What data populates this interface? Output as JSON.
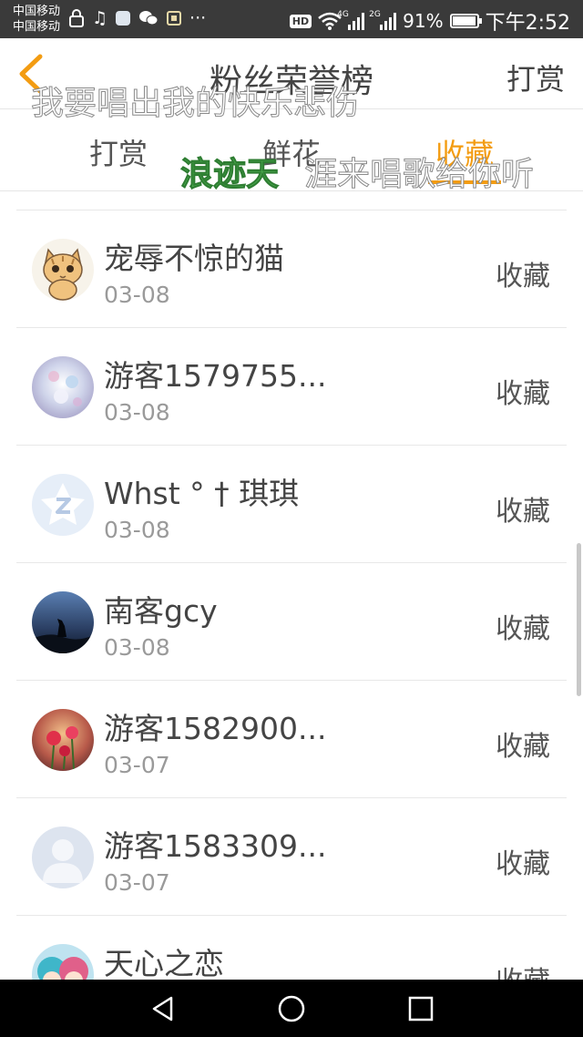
{
  "status_bar": {
    "carrier_1": "中国移动",
    "carrier_2": "中国移动",
    "more": "···",
    "hd": "HD",
    "net_a": "4G",
    "net_b": "2G",
    "battery": "91%",
    "time": "下午2:52"
  },
  "header": {
    "title": "粉丝荣誉榜",
    "action": "打赏"
  },
  "tabs": [
    {
      "label": "打赏"
    },
    {
      "label": "鲜花"
    },
    {
      "label": "收藏",
      "active": true
    }
  ],
  "danmaku": [
    {
      "text": "我要唱出我的快乐悲伤"
    },
    {
      "text": "浪迹天"
    },
    {
      "text": "涯来唱歌给你听"
    }
  ],
  "list": [
    {
      "name": "宠辱不惊的猫",
      "date": "03-08",
      "badge": "收藏",
      "avatar": "cat-avatar"
    },
    {
      "name": "游客1579755...",
      "date": "03-08",
      "badge": "收藏",
      "avatar": "blossom-avatar"
    },
    {
      "name": "Whst ° † 琪琪",
      "date": "03-08",
      "badge": "收藏",
      "avatar": "qq-logo-avatar"
    },
    {
      "name": "南客gcy",
      "date": "03-08",
      "badge": "收藏",
      "avatar": "wolf-night-avatar"
    },
    {
      "name": "游客1582900...",
      "date": "03-07",
      "badge": "收藏",
      "avatar": "flower-avatar"
    },
    {
      "name": "游客1583309...",
      "date": "03-07",
      "badge": "收藏",
      "avatar": "default-user-avatar"
    },
    {
      "name": "天心之恋",
      "date": "",
      "badge": "收藏",
      "avatar": "anime-avatar"
    }
  ],
  "colors": {
    "accent": "#f39c12",
    "status_bar": "#3a3a3a",
    "nav_bar": "#000000",
    "danmaku_green": "#4caf50"
  }
}
